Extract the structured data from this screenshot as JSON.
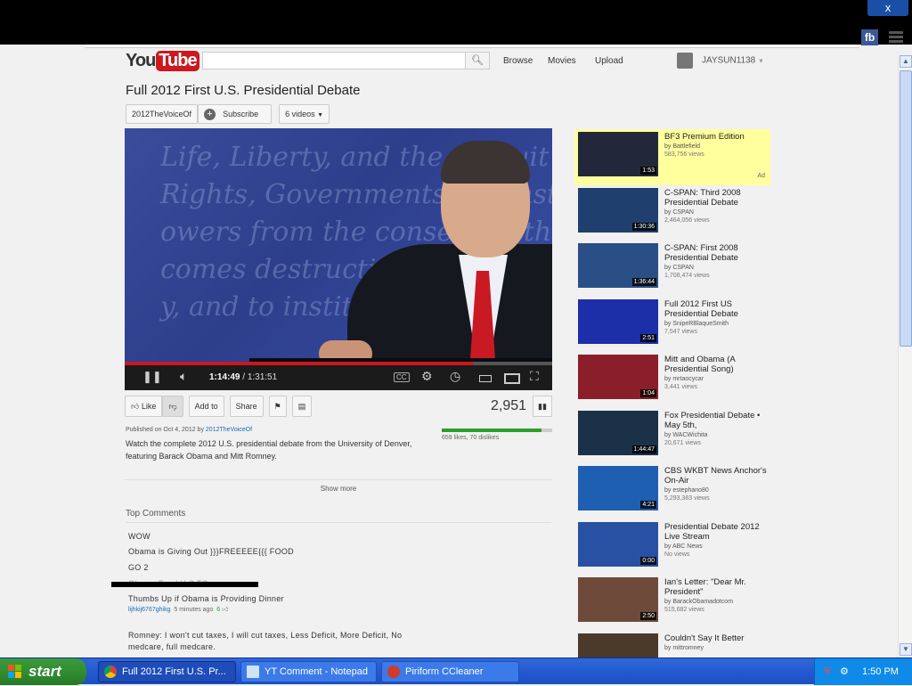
{
  "browser": {
    "close_glyph": "x",
    "fb_label": "fb"
  },
  "header": {
    "logo_you": "You",
    "logo_tube": "Tube",
    "search_placeholder": "",
    "nav": [
      "Browse",
      "Movies",
      "Upload"
    ],
    "username": "JAYSUN1138"
  },
  "video": {
    "title": "Full 2012 First U.S. Presidential Debate",
    "channel": "2012TheVoiceOf",
    "subscribe": "Subscribe",
    "videos_dropdown": "6 videos",
    "current_time": "1:14:49",
    "duration": "1:31:51",
    "progress": 0.815,
    "cc_label": "CC",
    "background_text": [
      "Life, Liberty, and the pursuit of",
      "Rights, Governments are instituted a",
      "owers from the consent of the governe",
      "comes destructive of these",
      "y, and to institute new"
    ],
    "actions": {
      "like": "Like",
      "add_to": "Add to",
      "share": "Share"
    },
    "view_count": "2,951",
    "likes_text": "659 likes, 70 dislikes",
    "like_ratio": 0.904,
    "published_prefix": "Published on Oct 4, 2012 by",
    "published_by": "2012TheVoiceOf",
    "description": "Watch the complete 2012 U.S. presidential debate from the University of Denver, featuring Barack Obama and Mitt Romney.",
    "show_more": "Show more"
  },
  "comments": {
    "heading": "Top Comments",
    "lines": [
      "WOW",
      "Obama is Giving Out }}}FREEEEE{{{ FOOD",
      "GO 2"
    ],
    "partial": "Obama Food U.S.TO",
    "thumbs": "Thumbs Up if Obama is Providing Dinner",
    "author": "lijhkij6767ghikg",
    "time": "5 minutes ago",
    "votes": "6",
    "romney": "Romney: I won't cut taxes, I will cut taxes, Less Deficit, More Deficit, No medcare, full medcare."
  },
  "sidebar": [
    {
      "title": "BF3 Premium Edition",
      "by": "by Battlefield",
      "views": "583,756 views",
      "dur": "1:53",
      "ad": "Ad"
    },
    {
      "title": "C-SPAN: Third 2008 Presidential Debate",
      "by": "by CSPAN",
      "views": "2,464,056 views",
      "dur": "1:30:36"
    },
    {
      "title": "C-SPAN: First 2008 Presidential Debate",
      "by": "by CSPAN",
      "views": "1,708,474 views",
      "dur": "1:36:44"
    },
    {
      "title": "Full 2012 First US Presidential Debate",
      "by": "by SnipeRBlaqueSmith",
      "views": "7,547 views",
      "dur": "2:51"
    },
    {
      "title": "Mitt and Obama (A Presidential Song)",
      "by": "by mrtaocycar",
      "views": "3,441 views",
      "dur": "1:04"
    },
    {
      "title": "Fox Presidential Debate • May 5th,",
      "by": "by WACWichita",
      "views": "20,671 views",
      "dur": "1:44:47"
    },
    {
      "title": "CBS WKBT News Anchor's On-Air",
      "by": "by estephano80",
      "views": "5,293,383 views",
      "dur": "4:21"
    },
    {
      "title": "Presidential Debate 2012 Live Stream",
      "by": "by ABC News",
      "views": "No views",
      "dur": "0:00"
    },
    {
      "title": "Ian's Letter: \"Dear Mr. President\"",
      "by": "by BarackObamadotcom",
      "views": "515,682 views",
      "dur": "2:50"
    },
    {
      "title": "Couldn't Say It Better",
      "by": "by mittromney",
      "views": "",
      "dur": ""
    }
  ],
  "taskbar": {
    "start": "start",
    "tasks": [
      "Full 2012 First U.S. Pr...",
      "YT Comment - Notepad",
      "Piriform CCleaner"
    ],
    "clock": "1:50 PM"
  },
  "colors": {
    "accent_red": "#cc181e",
    "ad_highlight": "#ffff9e",
    "taskbar_blue": "#245ad1",
    "start_green": "#2f8a2f"
  }
}
